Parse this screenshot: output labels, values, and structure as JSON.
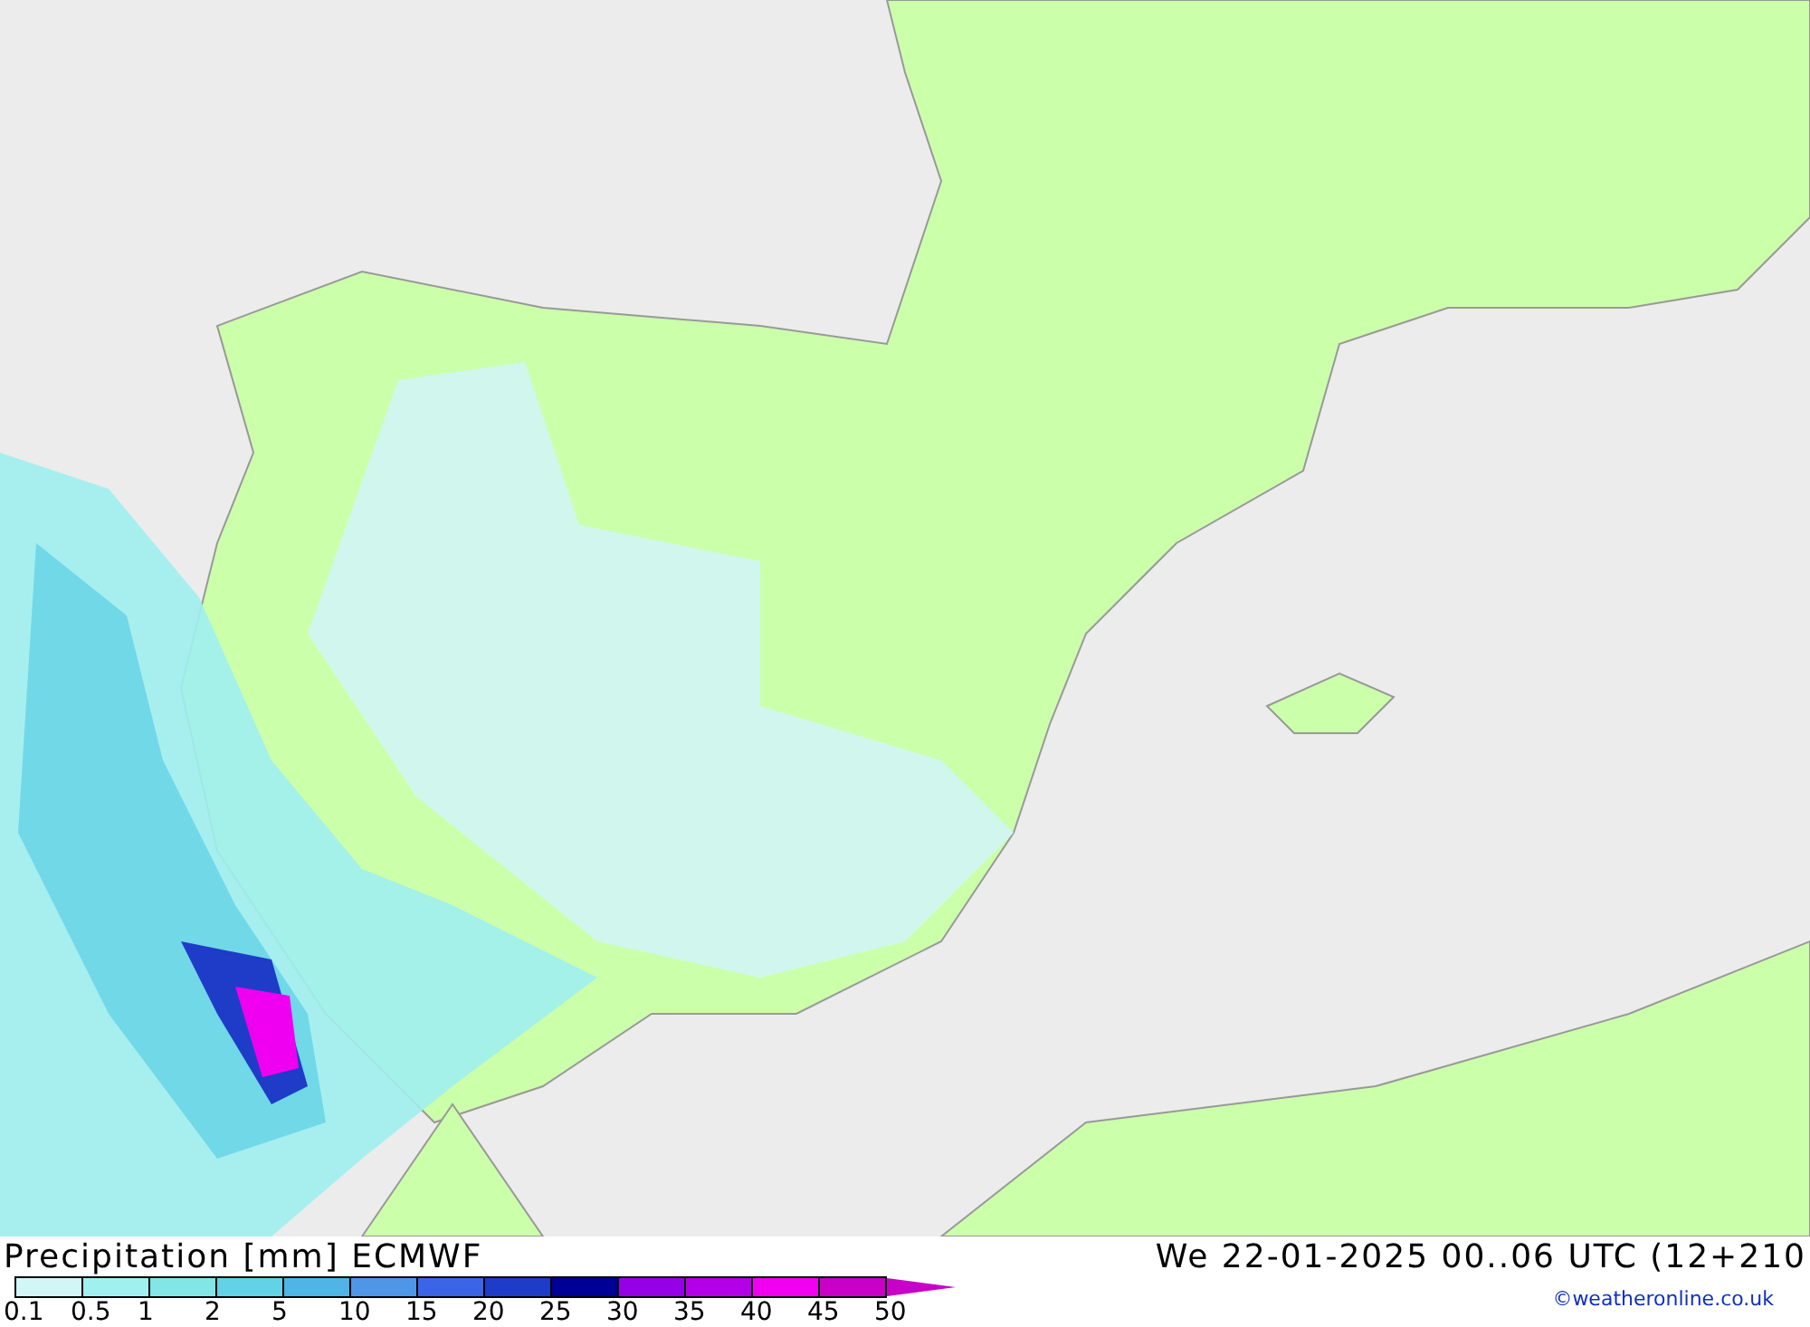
{
  "title": "Precipitation [mm] ECMWF",
  "valid_time": "We 22-01-2025 00..06 UTC (12+210",
  "legend": [
    {
      "label": "0.1",
      "color": "#d2f5f5"
    },
    {
      "label": "0.5",
      "color": "#a0f0f0"
    },
    {
      "label": "1",
      "color": "#82e6e6"
    },
    {
      "label": "2",
      "color": "#64d2e6"
    },
    {
      "label": "5",
      "color": "#50b4e6"
    },
    {
      "label": "10",
      "color": "#5096e6"
    },
    {
      "label": "15",
      "color": "#3c64e6"
    },
    {
      "label": "20",
      "color": "#1e3cc8"
    },
    {
      "label": "25",
      "color": "#000096"
    },
    {
      "label": "30",
      "color": "#9600e6"
    },
    {
      "label": "35",
      "color": "#b400e6"
    },
    {
      "label": "40",
      "color": "#f000f0"
    },
    {
      "label": "45",
      "color": "#c800c8"
    }
  ],
  "legend_end_label": "50",
  "credit": "©weatheronline.co.uk"
}
